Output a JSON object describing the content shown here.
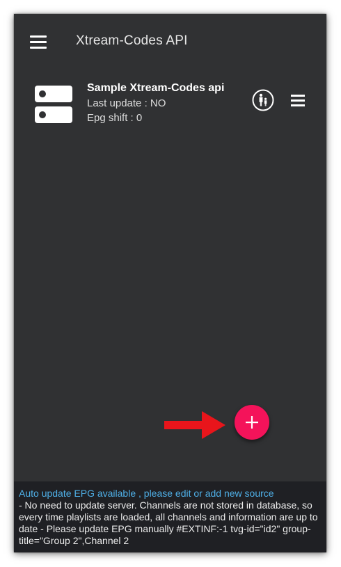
{
  "toolbar": {
    "title": "Xtream-Codes API",
    "menu_icon": "hamburger-menu-icon"
  },
  "sources": [
    {
      "name": "Sample Xtream-Codes api",
      "last_update": "Last update : NO",
      "epg_shift": "Epg shift : 0",
      "icon": "server-icon",
      "action_icons": [
        "parental-control-icon",
        "item-menu-icon"
      ]
    }
  ],
  "fab": {
    "icon": "plus-icon",
    "color": "#f4135a"
  },
  "annotation": {
    "icon": "red-arrow-icon",
    "color": "#e8151b"
  },
  "info": {
    "link": "Auto update EPG available , please edit or add new source",
    "text": "- No need to update server. Channels are not stored in database, so every time playlists are loaded, all channels and information are up to date - Please update EPG manually #EXTINF:-1 tvg-id=\"id2\" group-title=\"Group 2\",Channel 2"
  },
  "colors": {
    "background": "#303133",
    "panel": "#1f2024",
    "link": "#4fb0e8"
  }
}
